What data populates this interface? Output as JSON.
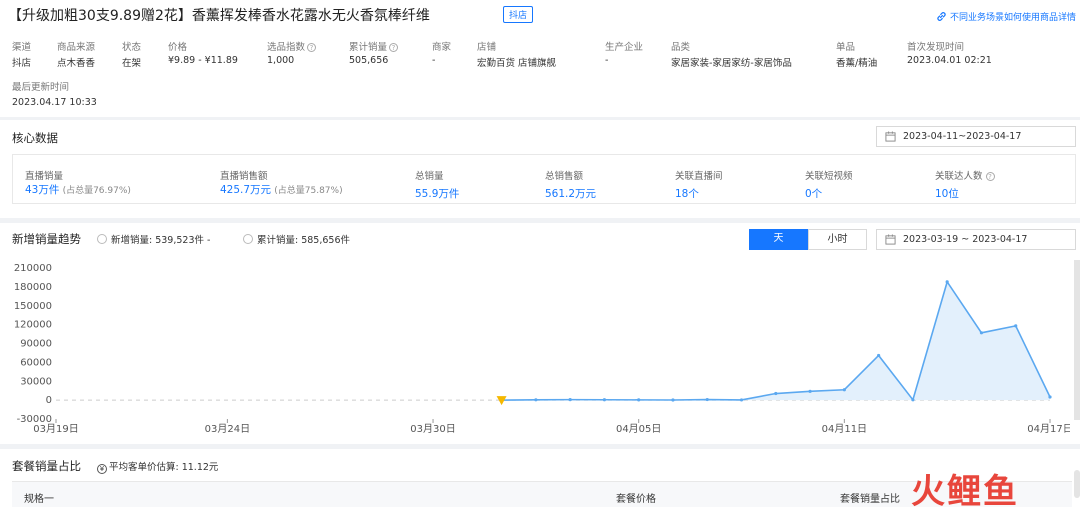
{
  "product": {
    "title": "【升级加粗30支9.89赠2花】香薰挥发棒香水花露水无火香氛棒纤维",
    "tag": "抖店",
    "top_link": "不同业务场景如何使用商品详情",
    "fields": [
      {
        "label": "渠道",
        "value": "抖店"
      },
      {
        "label": "商品来源",
        "value": "点木香香"
      },
      {
        "label": "状态",
        "value": "在架"
      },
      {
        "label": "价格",
        "value": "¥9.89 - ¥11.89"
      },
      {
        "label": "选品指数",
        "value": "1,000"
      },
      {
        "label": "累计销量",
        "value": "505,656"
      },
      {
        "label": "商家",
        "value": "-"
      },
      {
        "label": "店铺",
        "value": "宏勤百货 店铺旗舰"
      },
      {
        "label": "生产企业",
        "value": "-"
      },
      {
        "label": "品类",
        "value": "家居家装-家居家纺-家居饰品"
      },
      {
        "label": "单品",
        "value": "香薰/精油"
      },
      {
        "label": "首次发现时间",
        "value": "2023.04.01 02:21"
      }
    ],
    "last_update_label": "最后更新时间",
    "last_update_value": "2023.04.17 10:33"
  },
  "core": {
    "title": "核心数据",
    "date_range": "2023-04-11~2023-04-17",
    "stats": [
      {
        "label": "直播销量",
        "value": "43万件",
        "sub": "(占总量76.97%)"
      },
      {
        "label": "直播销售额",
        "value": "425.7万元",
        "sub": "(占总量75.87%)"
      },
      {
        "label": "总销量",
        "value": "55.9万件",
        "sub": ""
      },
      {
        "label": "总销售额",
        "value": "561.2万元",
        "sub": ""
      },
      {
        "label": "关联直播间",
        "value": "18个",
        "sub": ""
      },
      {
        "label": "关联短视频",
        "value": "0个",
        "sub": ""
      },
      {
        "label": "关联达人数",
        "value": "10位",
        "sub": ""
      }
    ]
  },
  "trend": {
    "title": "新增销量趋势",
    "legend_new": "新增销量: 539,523件 -",
    "legend_total": "累计销量: 585,656件",
    "tab_day": "天",
    "tab_hour": "小时",
    "date_range": "2023-03-19 ~ 2023-04-17"
  },
  "meal": {
    "title": "套餐销量占比",
    "avg_label": "平均客单价估算: 11.12元",
    "col_spec": "规格一",
    "col_price": "套餐价格",
    "col_share": "套餐销量占比"
  },
  "watermark": "火鲤鱼",
  "colors": {
    "accent": "#1677ff",
    "area": "#e3f0fc",
    "line": "#5ba8f0",
    "marker": "#f5b800"
  },
  "chart_data": {
    "type": "area",
    "title": "",
    "xlabel": "",
    "ylabel": "",
    "ylim": [
      -30000,
      210000
    ],
    "yticks": [
      210000,
      180000,
      150000,
      120000,
      90000,
      60000,
      30000,
      0,
      -30000
    ],
    "xtick_labels": [
      "03月19日",
      "03月24日",
      "03月30日",
      "04月05日",
      "04月11日",
      "04月17日"
    ],
    "xtick_index": [
      0,
      5,
      11,
      17,
      23,
      29
    ],
    "x": [
      "03-19",
      "03-20",
      "03-21",
      "03-22",
      "03-23",
      "03-24",
      "03-25",
      "03-26",
      "03-27",
      "03-28",
      "03-29",
      "03-30",
      "03-31",
      "04-01",
      "04-02",
      "04-03",
      "04-04",
      "04-05",
      "04-06",
      "04-07",
      "04-08",
      "04-09",
      "04-10",
      "04-11",
      "04-12",
      "04-13",
      "04-14",
      "04-15",
      "04-16",
      "04-17"
    ],
    "series": [
      {
        "values": [
          null,
          null,
          null,
          null,
          null,
          null,
          null,
          null,
          null,
          null,
          null,
          null,
          null,
          0,
          500,
          800,
          600,
          400,
          200,
          900,
          300,
          10500,
          14000,
          16500,
          71000,
          500,
          188000,
          107000,
          118000,
          5000
        ]
      }
    ],
    "marker_index": 13,
    "grid": false
  }
}
